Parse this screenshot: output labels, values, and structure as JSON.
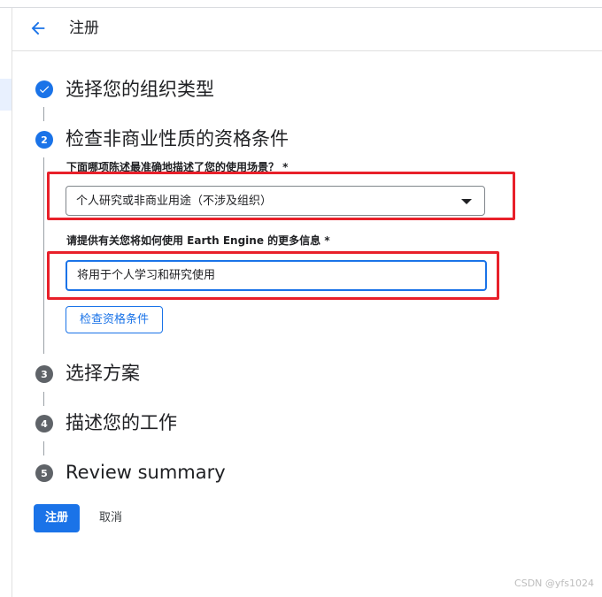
{
  "header": {
    "title": "注册",
    "back_icon": "arrow-back-icon"
  },
  "steps": [
    {
      "number": "1",
      "state": "done",
      "icon": "check-icon",
      "title": "选择您的组织类型"
    },
    {
      "number": "2",
      "state": "active",
      "title": "检查非商业性质的资格条件"
    },
    {
      "number": "3",
      "state": "pending",
      "title": "选择方案"
    },
    {
      "number": "4",
      "state": "pending",
      "title": "描述您的工作"
    },
    {
      "number": "5",
      "state": "pending",
      "title": "Review summary"
    }
  ],
  "form": {
    "usage_label": "下面哪项陈述最准确地描述了您的使用场景？ *",
    "usage_value": "个人研究或非商业用途（不涉及组织）",
    "details_label": "请提供有关您将如何使用 Earth Engine 的更多信息 *",
    "details_value": "将用于个人学习和研究使用",
    "check_button": "检查资格条件"
  },
  "actions": {
    "register": "注册",
    "cancel": "取消"
  },
  "watermark": "CSDN @yfs1024",
  "colors": {
    "accent": "#1a73e8",
    "highlight_frame": "#e8202a",
    "pending_step": "#5f6368"
  }
}
